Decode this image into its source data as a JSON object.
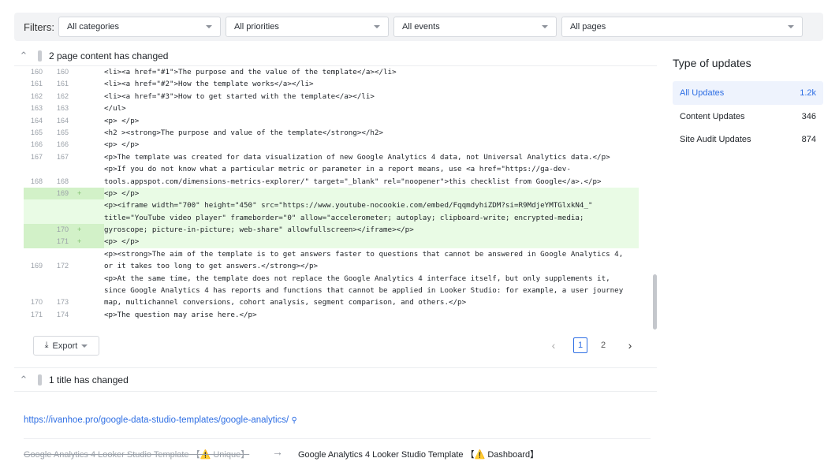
{
  "filters": {
    "label": "Filters:",
    "categories": "All categories",
    "priorities": "All priorities",
    "events": "All events",
    "pages": "All pages"
  },
  "content_section": {
    "title": "2 page content has changed",
    "rows": [
      {
        "old": "160",
        "new": "160",
        "sign": "",
        "code": "<li><a href=\"#1\">The purpose and the value of the template</a></li>",
        "type": ""
      },
      {
        "old": "161",
        "new": "161",
        "sign": "",
        "code": "<li><a href=\"#2\">How the template works</a></li>",
        "type": ""
      },
      {
        "old": "162",
        "new": "162",
        "sign": "",
        "code": "<li><a href=\"#3\">How to get started with the template</a></li>",
        "type": ""
      },
      {
        "old": "163",
        "new": "163",
        "sign": "",
        "code": "</ul>",
        "type": ""
      },
      {
        "old": "164",
        "new": "164",
        "sign": "",
        "code": "<p> </p>",
        "type": ""
      },
      {
        "old": "165",
        "new": "165",
        "sign": "",
        "code": "<h2 ><strong>The purpose and value of the template</strong></h2>",
        "type": ""
      },
      {
        "old": "166",
        "new": "166",
        "sign": "",
        "code": "<p> </p>",
        "type": ""
      },
      {
        "old": "167",
        "new": "167",
        "sign": "",
        "code": "<p>The template was created for data visualization of new Google Analytics 4 data, not Universal Analytics data.</p>",
        "type": ""
      },
      {
        "old": "",
        "new": "",
        "sign": "",
        "code": "<p>If you do not know what a particular metric or parameter in a report means, use <a href=\"https://ga-dev-",
        "type": ""
      },
      {
        "old": "168",
        "new": "168",
        "sign": "",
        "code": "tools.appspot.com/dimensions-metrics-explorer/\" target=\"_blank\" rel=\"noopener\">this checklist from Google</a>.</p>",
        "type": ""
      },
      {
        "old": "",
        "new": "169",
        "sign": "+",
        "code": "<p> </p>",
        "type": "add"
      },
      {
        "old": "",
        "new": "",
        "sign": "",
        "code": "<p><iframe width=\"700\" height=\"450\" src=\"https://www.youtube-nocookie.com/embed/FqqmdyhiZDM?si=R9MdjeYMTGlxkN4_\"",
        "type": "add"
      },
      {
        "old": "",
        "new": "",
        "sign": "",
        "code": "title=\"YouTube video player\" frameborder=\"0\" allow=\"accelerometer; autoplay; clipboard-write; encrypted-media;",
        "type": "add"
      },
      {
        "old": "",
        "new": "170",
        "sign": "+",
        "code": "gyroscope; picture-in-picture; web-share\" allowfullscreen></iframe></p>",
        "type": "add"
      },
      {
        "old": "",
        "new": "171",
        "sign": "+",
        "code": "<p> </p>",
        "type": "add"
      },
      {
        "old": "",
        "new": "",
        "sign": "",
        "code": "<p><strong>The aim of the template is to get answers faster to questions that cannot be answered in Google Analytics 4,",
        "type": ""
      },
      {
        "old": "169",
        "new": "172",
        "sign": "",
        "code": "or it takes too long to get answers.</strong></p>",
        "type": ""
      },
      {
        "old": "",
        "new": "",
        "sign": "",
        "code": "<p>At the same time, the template does not replace the Google Analytics 4 interface itself, but only supplements it,",
        "type": ""
      },
      {
        "old": "",
        "new": "",
        "sign": "",
        "code": "since Google Analytics 4 has reports and functions that cannot be applied in Looker Studio: for example, a user journey",
        "type": ""
      },
      {
        "old": "170",
        "new": "173",
        "sign": "",
        "code": "map, multichannel conversions, cohort analysis, segment comparison, and others.</p>",
        "type": ""
      },
      {
        "old": "171",
        "new": "174",
        "sign": "",
        "code": "<p>The question may arise here.</p>",
        "type": ""
      }
    ],
    "export_label": "Export",
    "pages": [
      "1",
      "2"
    ]
  },
  "title_section": {
    "title": "1 title has changed",
    "url": "https://ivanhoe.pro/google-data-studio-templates/google-analytics/",
    "old_title": "Google Analytics 4 Looker Studio Template 【⚠️ Unique】",
    "new_title": "Google Analytics 4 Looker Studio Template 【⚠️ Dashboard】"
  },
  "sidebar": {
    "title": "Type of updates",
    "items": [
      {
        "label": "All Updates",
        "count": "1.2k"
      },
      {
        "label": "Content Updates",
        "count": "346"
      },
      {
        "label": "Site Audit Updates",
        "count": "874"
      }
    ]
  },
  "colors": {
    "accent": "#2f6fe4",
    "added_bg": "#e9fbe5"
  }
}
